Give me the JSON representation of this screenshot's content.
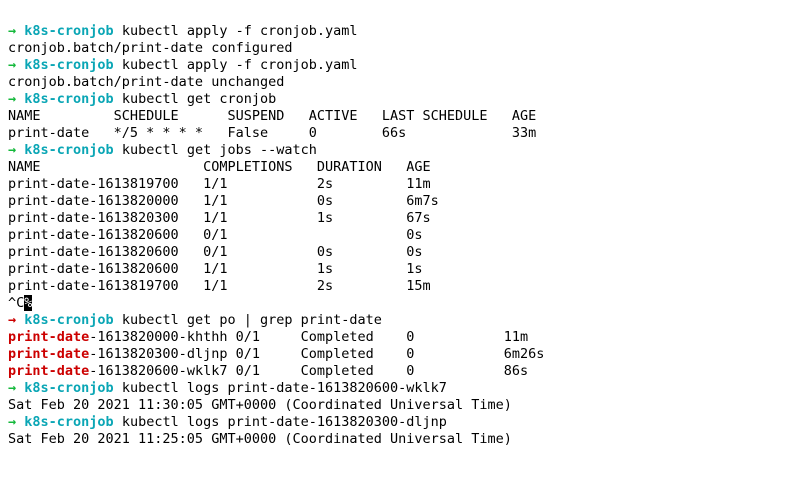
{
  "colors": {
    "arrow_green": "#14b83b",
    "arrow_red": "#cc0000",
    "prompt": "#0aa6b5",
    "match": "#cc0000"
  },
  "prompt_dir": "k8s-cronjob",
  "commands": {
    "apply1": "kubectl apply -f cronjob.yaml",
    "apply1_out": "cronjob.batch/print-date configured",
    "apply2": "kubectl apply -f cronjob.yaml",
    "apply2_out": "cronjob.batch/print-date unchanged",
    "get_cronjob": "kubectl get cronjob",
    "cronjob_header": "NAME         SCHEDULE      SUSPEND   ACTIVE   LAST SCHEDULE   AGE",
    "cronjob_row": "print-date   */5 * * * *   False     0        66s             33m",
    "get_jobs": "kubectl get jobs --watch",
    "jobs_header": "NAME                    COMPLETIONS   DURATION   AGE",
    "jobs": [
      {
        "name": "print-date-1613819700",
        "completions": "1/1",
        "duration": "2s",
        "age": "11m"
      },
      {
        "name": "print-date-1613820000",
        "completions": "1/1",
        "duration": "0s",
        "age": "6m7s"
      },
      {
        "name": "print-date-1613820300",
        "completions": "1/1",
        "duration": "1s",
        "age": "67s"
      },
      {
        "name": "print-date-1613820600",
        "completions": "0/1",
        "duration": "",
        "age": "0s"
      },
      {
        "name": "print-date-1613820600",
        "completions": "0/1",
        "duration": "0s",
        "age": "0s"
      },
      {
        "name": "print-date-1613820600",
        "completions": "1/1",
        "duration": "1s",
        "age": "1s"
      },
      {
        "name": "print-date-1613819700",
        "completions": "1/1",
        "duration": "2s",
        "age": "15m"
      }
    ],
    "interrupt_pre": "^C",
    "interrupt_block": "%",
    "get_po": "kubectl get po | grep print-date",
    "pods": [
      {
        "match": "print-date",
        "rest": "-1613820000-khthh",
        "ready": "0/1",
        "status": "Completed",
        "restarts": "0",
        "age": "11m"
      },
      {
        "match": "print-date",
        "rest": "-1613820300-dljnp",
        "ready": "0/1",
        "status": "Completed",
        "restarts": "0",
        "age": "6m26s"
      },
      {
        "match": "print-date",
        "rest": "-1613820600-wklk7",
        "ready": "0/1",
        "status": "Completed",
        "restarts": "0",
        "age": "86s"
      }
    ],
    "logs1": "kubectl logs print-date-1613820600-wklk7",
    "logs1_out": "Sat Feb 20 2021 11:30:05 GMT+0000 (Coordinated Universal Time)",
    "logs2": "kubectl logs print-date-1613820300-dljnp",
    "logs2_out": "Sat Feb 20 2021 11:25:05 GMT+0000 (Coordinated Universal Time)"
  }
}
